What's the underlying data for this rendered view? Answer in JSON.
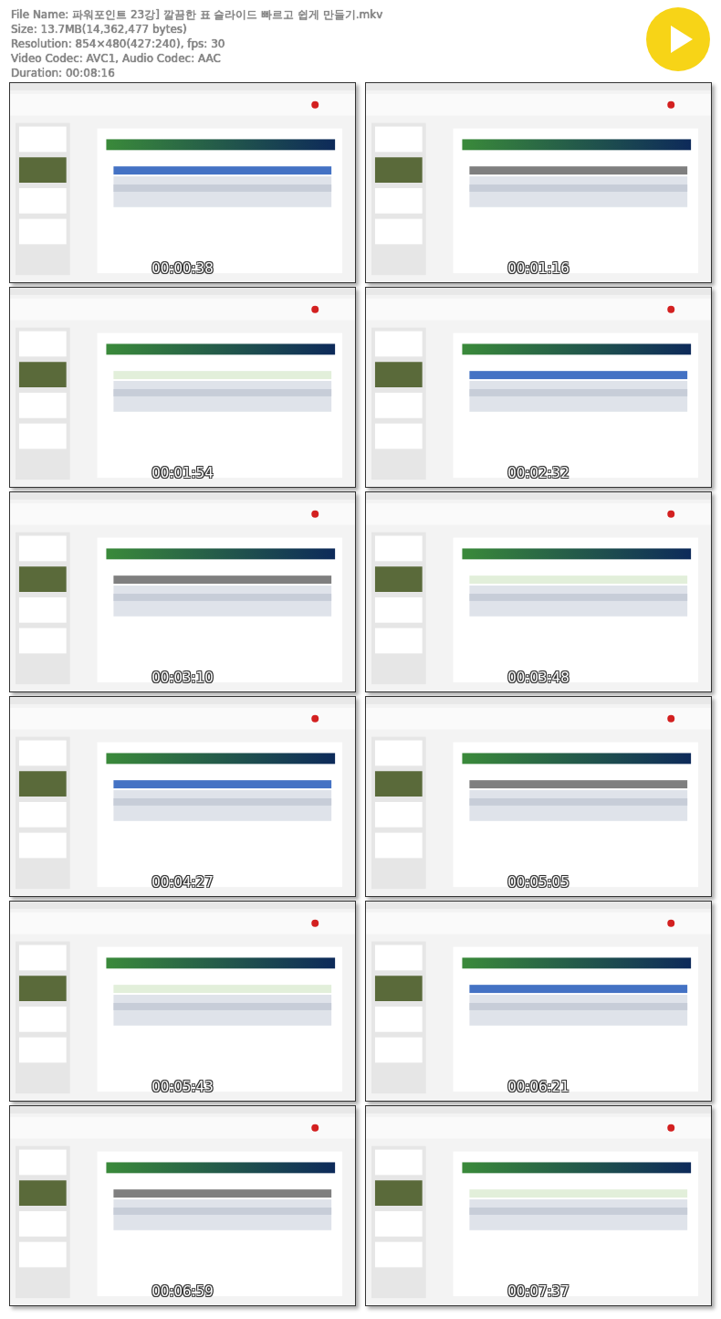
{
  "header": {
    "lines": [
      "File Name: 파워포인트 23강] 깔끔한 표 슬라이드 빠르고 쉽게 만들기.mkv",
      "Size: 13.7MB(14,362,477 bytes)",
      "Resolution: 854×480(427:240), fps: 30",
      "Video Codec: AVC1, Audio Codec: AAC",
      "Duration: 00:08:16"
    ]
  },
  "frames": [
    {
      "kind": "picture",
      "timestamp": "00:00:38"
    },
    {
      "kind": "picture",
      "timestamp": "00:01:16"
    },
    {
      "kind": "picture",
      "timestamp": "00:01:54"
    },
    {
      "kind": "picture",
      "timestamp": "00:02:32"
    },
    {
      "kind": "picture",
      "timestamp": "00:03:10"
    },
    {
      "kind": "picture",
      "timestamp": "00:03:48"
    },
    {
      "kind": "picture",
      "timestamp": "00:04:27"
    },
    {
      "kind": "picture",
      "timestamp": "00:05:05"
    },
    {
      "kind": "picture",
      "timestamp": "00:05:43"
    },
    {
      "kind": "picture",
      "timestamp": "00:06:21"
    },
    {
      "kind": "picture",
      "timestamp": "00:06:59"
    },
    {
      "kind": "picture",
      "timestamp": "00:07:37"
    }
  ]
}
